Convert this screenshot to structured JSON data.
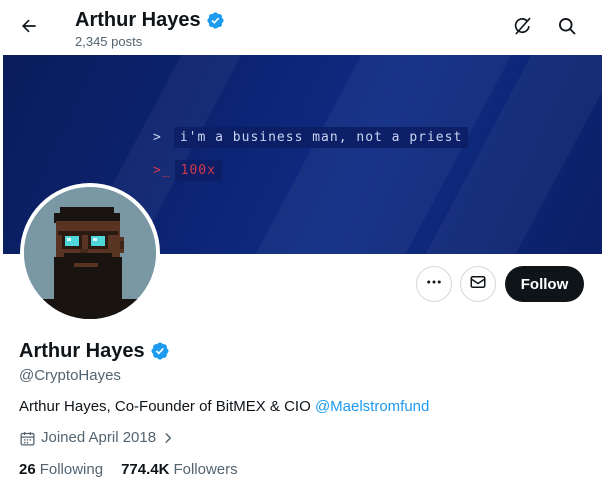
{
  "header": {
    "name": "Arthur Hayes",
    "posts_count": "2,345 posts"
  },
  "banner": {
    "line1_prompt": ">",
    "line1_text": "i'm a business man, not a priest",
    "line2_prompt": ">_",
    "line2_text": "100x"
  },
  "actions": {
    "follow_label": "Follow"
  },
  "profile": {
    "name": "Arthur Hayes",
    "handle": "@CryptoHayes",
    "bio_text": "Arthur Hayes, Co-Founder of BitMEX & CIO ",
    "bio_mention": "@Maelstromfund",
    "joined": "Joined April 2018",
    "following_count": "26",
    "following_label": "Following",
    "followers_count": "774.4K",
    "followers_label": "Followers"
  },
  "icons": {
    "back": "arrow-left-icon",
    "grok": "grok-icon",
    "search": "search-icon",
    "more": "more-dots-icon",
    "message": "envelope-icon",
    "verified": "verified-badge-icon",
    "calendar": "calendar-icon",
    "chevron": "chevron-right-icon"
  },
  "colors": {
    "accent": "#1d9bf0",
    "text_primary": "#0f1419",
    "text_secondary": "#536471",
    "follow_button": "#0f1419",
    "banner": "#0c2474"
  }
}
